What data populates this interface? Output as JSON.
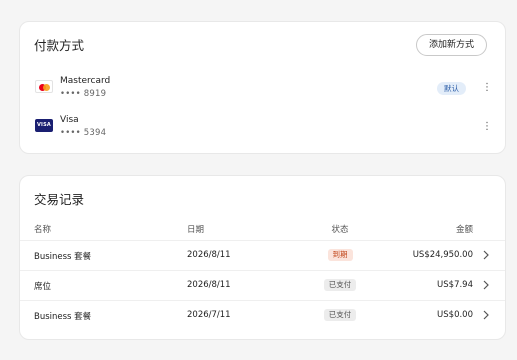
{
  "payment": {
    "title": "付款方式",
    "add_button": "添加新方式",
    "methods": [
      {
        "brand": "Mastercard",
        "number": "•••• 8919",
        "icon": "mastercard-icon",
        "badge": "默认"
      },
      {
        "brand": "Visa",
        "number": "•••• 5394",
        "icon": "visa-icon",
        "icon_text": "VISA"
      }
    ]
  },
  "transactions": {
    "title": "交易记录",
    "headers": {
      "name": "名称",
      "date": "日期",
      "status": "状态",
      "amount": "金额"
    },
    "rows": [
      {
        "name": "Business 套餐",
        "date": "2026/8/11",
        "status": "到期",
        "amount": "US$24,950.00"
      },
      {
        "name": "席位",
        "date": "2026/8/11",
        "status": "已支付",
        "amount": "US$7.94"
      },
      {
        "name": "Business 套餐",
        "date": "2026/7/11",
        "status": "已支付",
        "amount": "US$0.00"
      }
    ]
  },
  "colors": {
    "expired_bg": "#fbe4dc",
    "expired_text": "#c2481c",
    "paid_bg": "#ececec",
    "default_badge_bg": "#e3edf9",
    "default_badge_text": "#2d5ea8"
  }
}
